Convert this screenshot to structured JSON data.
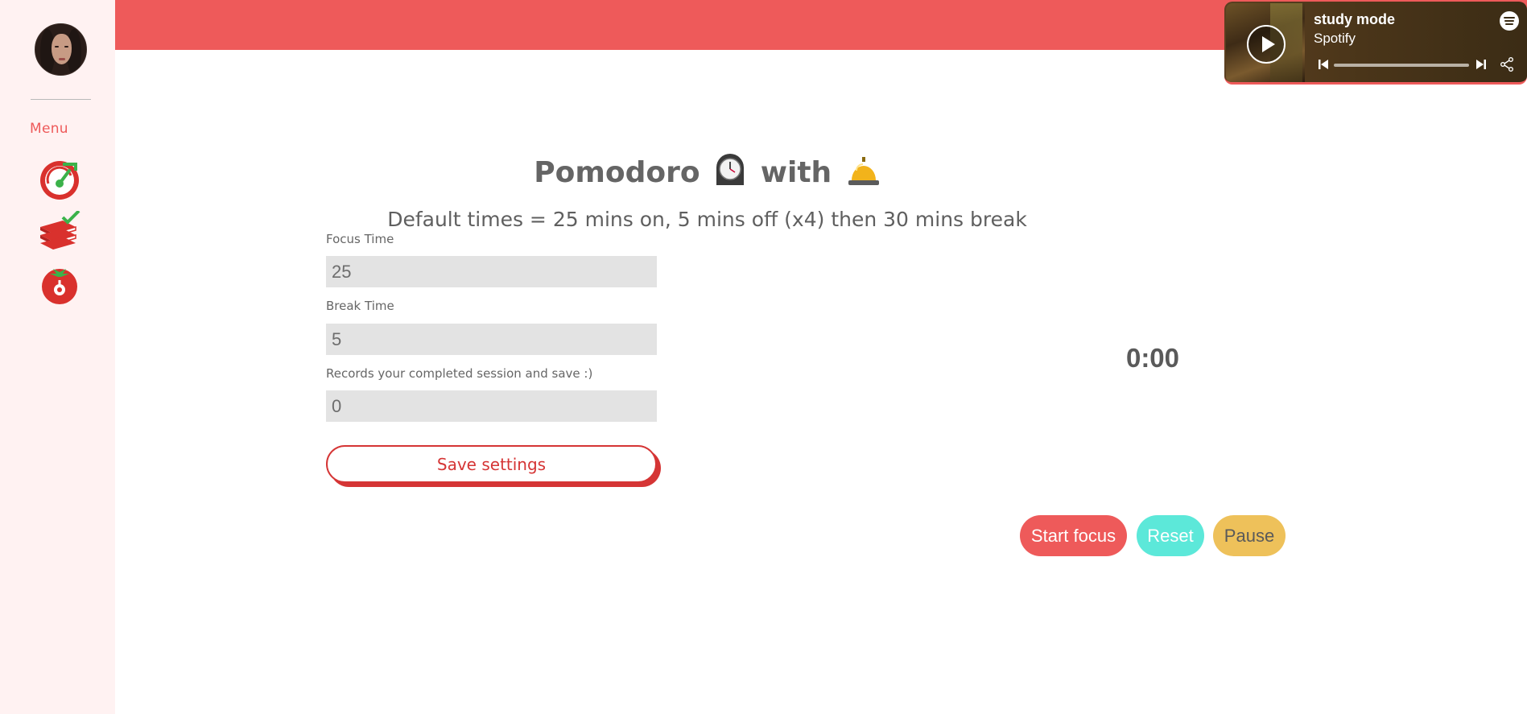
{
  "sidebar": {
    "menu_label": "Menu",
    "nav_items": [
      {
        "icon": "speedometer-icon"
      },
      {
        "icon": "books-checklist-icon"
      },
      {
        "icon": "tomato-timer-icon"
      }
    ]
  },
  "spotify": {
    "track_title": "study mode",
    "artist": "Spotify"
  },
  "main": {
    "title_prefix": "Pomodoro",
    "title_middle": "with",
    "subtitle": "Default times = 25 mins on, 5 mins off (x4) then 30 mins break",
    "fields": {
      "focus_label": "Focus Time",
      "focus_value": "25",
      "break_label": "Break Time",
      "break_value": "5",
      "records_label": "Records your completed session and save :)",
      "records_value": "0"
    },
    "save_button": "Save settings",
    "timer": "0:00",
    "controls": {
      "start": "Start focus",
      "reset": "Reset",
      "pause": "Pause"
    }
  },
  "colors": {
    "accent": "#ee5a5a",
    "reset": "#5ce8d9",
    "pause": "#eec15a",
    "save_border": "#d53535",
    "sidebar_bg": "#fff2f2"
  }
}
